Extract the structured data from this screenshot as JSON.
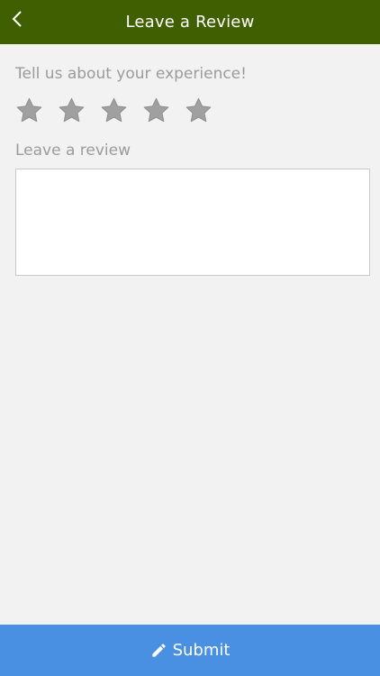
{
  "header": {
    "title": "Leave a Review",
    "back_icon": "chevron-left-icon",
    "background_color": "#3f5f00"
  },
  "form": {
    "prompt": "Tell us about your experience!",
    "rating": {
      "max": 5,
      "value": 0,
      "star_color": "#a0a0a0"
    },
    "review_label": "Leave a review",
    "review_value": ""
  },
  "submit": {
    "label": "Submit",
    "icon": "pencil-icon",
    "background_color": "#4a90e2"
  }
}
